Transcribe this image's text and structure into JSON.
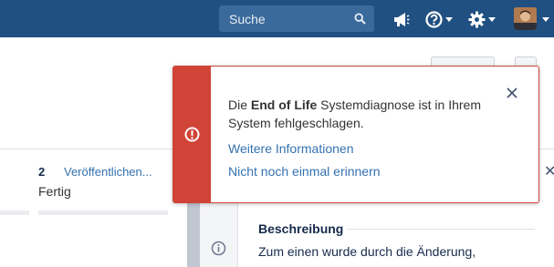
{
  "header": {
    "search_placeholder": "Suche",
    "icons": [
      "search-icon",
      "megaphone-icon",
      "help-icon",
      "gear-icon",
      "user-avatar"
    ],
    "bg_color": "#205081"
  },
  "main": {
    "count": "2",
    "publish_link": "Veröffentlichen...",
    "status": "Fertig"
  },
  "side_panel": {
    "description_title": "Beschreibung",
    "description_text": "Zum einen wurde durch die Änderung,"
  },
  "flag": {
    "type": "error",
    "color": "#d04437",
    "message_pre": "Die ",
    "message_bold": "End of Life",
    "message_post": " Systemdiagnose ist in Ihrem System fehlgeschlagen.",
    "link_more": "Weitere Informationen",
    "link_dismiss": "Nicht noch einmal erinnern"
  }
}
